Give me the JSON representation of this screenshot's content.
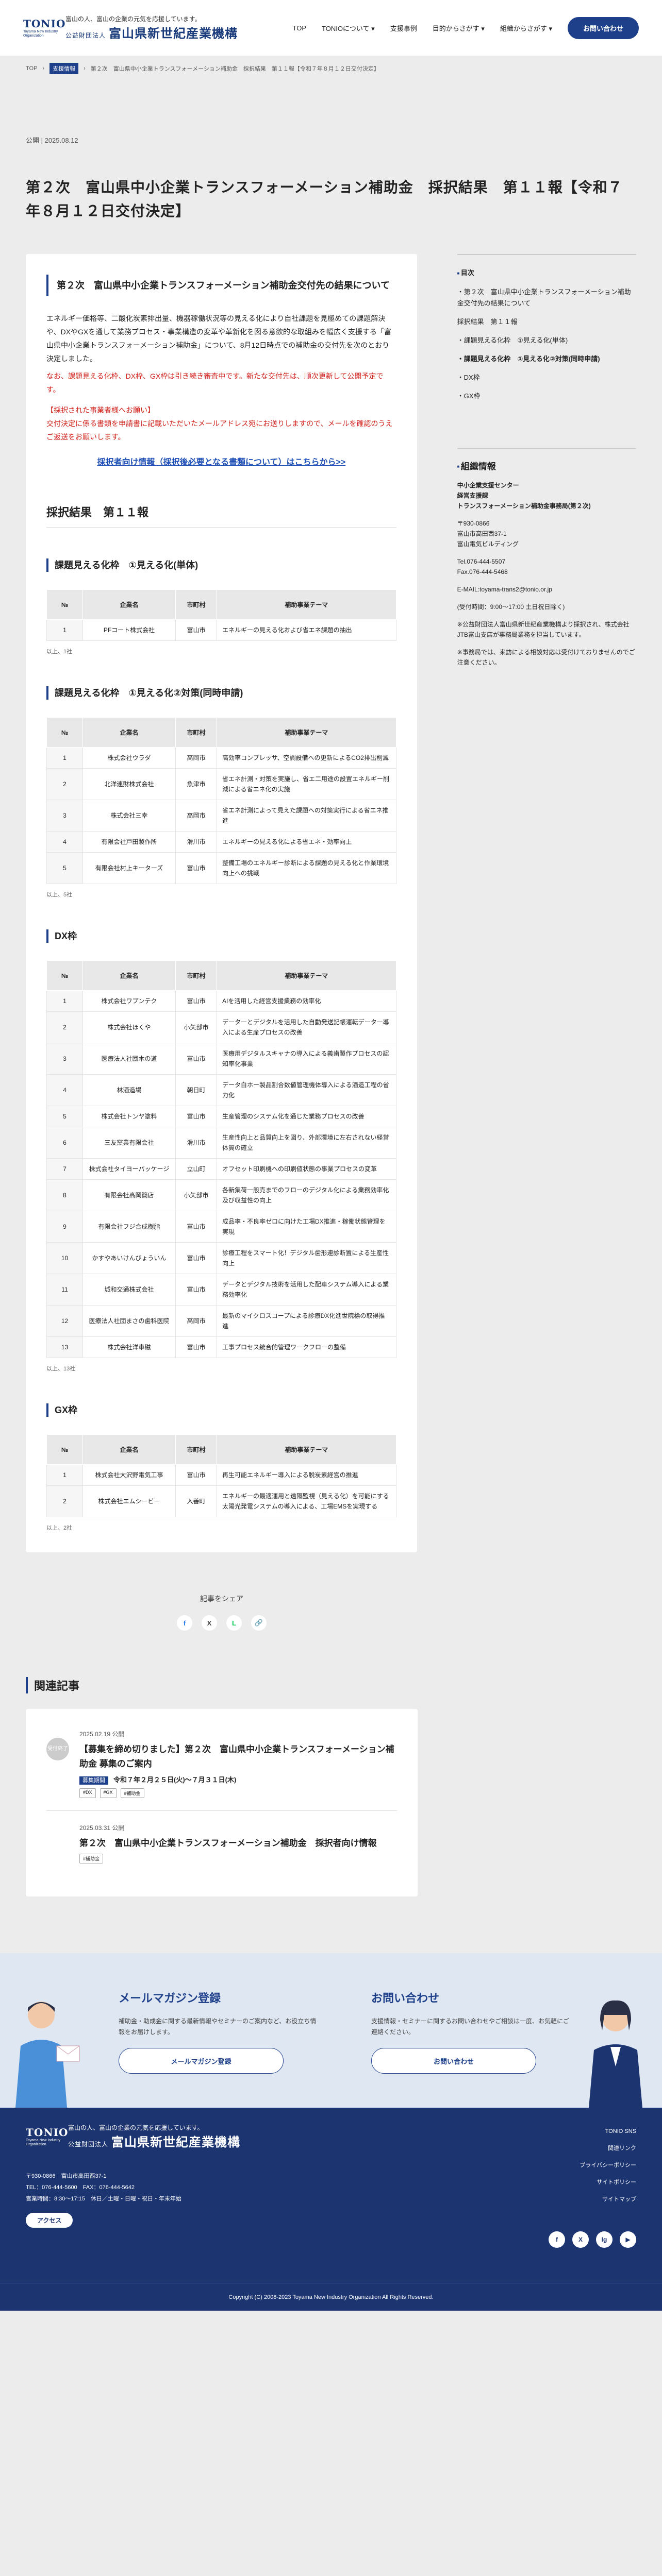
{
  "header": {
    "logo_mark": "TONIO",
    "logo_sub": "Toyama New Industry Organization",
    "tagline": "富山の人、富山の企業の元気を応援しています。",
    "org_prefix": "公益財団法人",
    "org_name": "富山県新世紀産業機構",
    "nav": [
      "TOP",
      "TONIOについて ▾",
      "支援事例",
      "目的からさがす ▾",
      "組織からさがす ▾"
    ],
    "contact": "お問い合わせ"
  },
  "breadcrumb": {
    "top": "TOP",
    "category": "支援情報",
    "current": "第２次　富山県中小企業トランスフォーメーション補助金　採択結果　第１１報【令和７年８月１２日交付決定】"
  },
  "article": {
    "date": "公開 | 2025.08.12",
    "title": "第２次　富山県中小企業トランスフォーメーション補助金　採択結果　第１１報【令和７年８月１２日交付決定】",
    "lead_title": "第２次　富山県中小企業トランスフォーメーション補助金交付先の結果について",
    "p1": "エネルギー価格等、二酸化炭素排出量、機器稼働状況等の見える化により自社課題を見極めての課題解決や、DXやGXを通して業務プロセス・事業構造の変革や革新化を図る意欲的な取組みを幅広く支援する「富山県中小企業トランスフォーメーション補助金」について、8月12日時点での補助金の交付先を次のとおり決定しました。",
    "p2": "なお、課題見える化枠、DX枠、GX枠は引き続き審査中です。新たな交付先は、順次更新して公開予定です。",
    "p3": "【採択された事業者様へお願い】",
    "p4": "交付決定に係る書類を申請書に記載いただいたメールアドレス宛にお送りしますので、メールを確認のうえご返送をお願いします。",
    "link": "採択者向け情報（採択後必要となる書類について）はこちらから>>",
    "results_title": "採択結果　第１１報",
    "col_no": "№",
    "col_company": "企業名",
    "col_city": "市町村",
    "col_theme": "補助事業テーマ",
    "more": "以上、1社",
    "more2": "以上、5社",
    "more3": "以上、13社",
    "more4": "以上、2社"
  },
  "tables": [
    {
      "title": "課題見える化枠　①見える化(単体)",
      "rows": [
        [
          "1",
          "PFコート株式会社",
          "富山市",
          "エネルギーの見える化および省エネ課題の抽出"
        ]
      ]
    },
    {
      "title": "課題見える化枠　①見える化②対策(同時申請)",
      "rows": [
        [
          "1",
          "株式会社ウラダ",
          "高岡市",
          "高効率コンプレッサ、空調設備への更新によるCO2排出削減"
        ],
        [
          "2",
          "北洋連財株式会社",
          "魚津市",
          "省エネ計測・対策を実施し、省エ二用途の設置エネルギー削減による省エネ化の実施"
        ],
        [
          "3",
          "株式会社三幸",
          "高岡市",
          "省エネ計測によって見えた課題への対策実行による省エネ推進"
        ],
        [
          "4",
          "有限会社戸田製作所",
          "滑川市",
          "エネルギーの見える化による省エネ・効率向上"
        ],
        [
          "5",
          "有限会社村上キーターズ",
          "富山市",
          "整備工場のエネルギー診断による課題の見える化と作業環境向上への挑戦"
        ]
      ]
    },
    {
      "title": "DX枠",
      "rows": [
        [
          "1",
          "株式会社ワプンテク",
          "富山市",
          "AIを活用した経営支援業務の効率化"
        ],
        [
          "2",
          "株式会社ほくや",
          "小矢部市",
          "データーとデジタルを活用した自動発送記帳運転データー導入による生産プロセスの改善"
        ],
        [
          "3",
          "医療法人社団木の道",
          "富山市",
          "医療用デジタルスキャナの導入による義歯製作プロセスの認知率化事業"
        ],
        [
          "4",
          "林酒造場",
          "朝日町",
          "データ白ホー製品割合数値管理機体導入による酒造工程の省力化"
        ],
        [
          "5",
          "株式会社トンヤ塗料",
          "富山市",
          "生産管理のシステム化を通じた業務プロセスの改善"
        ],
        [
          "6",
          "三友窯業有限会社",
          "滑川市",
          "生産性向上と品質向上を図り、外部環境に左右されない経営体質の確立"
        ],
        [
          "7",
          "株式会社タイヨーパッケージ",
          "立山町",
          "オフセット印刷機への印刷値状態の事業プロセスの変革"
        ],
        [
          "8",
          "有限会社高岡簡店",
          "小矢部市",
          "各新集荷一般売までのフローのデジタル化による業務効率化及び収益性の向上"
        ],
        [
          "9",
          "有限会社フジ合成樹脂",
          "富山市",
          "成品率・不良率ゼロに向けた工場DX推進・稼働状態管理を実現"
        ],
        [
          "10",
          "かすやあいけんびょういん",
          "富山市",
          "診療工程をスマート化！デジタル歯形連診断置による生産性向上"
        ],
        [
          "11",
          "城和交通株式会社",
          "富山市",
          "データとデジタル技術を活用した配車システム導入による業務効率化"
        ],
        [
          "12",
          "医療法人社団まさの歯科医院",
          "高岡市",
          "最新のマイクロスコープによる診療DX化進世院標の取得推進"
        ],
        [
          "13",
          "株式会社洋車磁",
          "富山市",
          "工事プロセス統合的管理ワークフローの整備"
        ]
      ]
    },
    {
      "title": "GX枠",
      "rows": [
        [
          "1",
          "株式会社大沢野電気工事",
          "富山市",
          "再生可能エネルギー導入による脱炭素経営の推進"
        ],
        [
          "2",
          "株式会社エムシービー",
          "入善町",
          "エネルギーの最適運用と遠隔監視（見える化）を可能にする太陽光発電システムの導入による、工場EMSを実現する"
        ]
      ]
    }
  ],
  "sidebar": {
    "toc_title": "目次",
    "toc": [
      "・第２次　富山県中小企業トランスフォーメーション補助金交付先の結果について",
      "採択結果　第１１報",
      "・課題見える化枠　①見える化(単体)",
      "・課題見える化枠　①見える化②対策(同時申請)",
      "・DX枠",
      "・GX枠"
    ],
    "info_title": "組織情報",
    "info_lines": [
      "中小企業支援センター",
      "経営支援課",
      "トランスフォーメーション補助金事務局(第２次)",
      "",
      "〒930-0866",
      "富山市高田西37-1",
      "富山電気ビルディング",
      "",
      "Tel.076-444-5507",
      "Fax.076-444-5468",
      "",
      "E-MAIL:toyama-trans2@tonio.or.jp",
      "",
      "(受付時間：9:00～17:00 土日祝日除く)",
      "",
      "※公益財団法人富山県新世紀産業機構より採択され、株式会社JTB富山支店が事務局業務を担当しています。",
      "",
      "※事務局では、来訪による相談対応は受付けておりませんのでご注意ください。"
    ]
  },
  "share": {
    "label": "記事をシェア",
    "icons": [
      "f",
      "X",
      "L",
      "🔗"
    ]
  },
  "related": {
    "title": "関連記事",
    "items": [
      {
        "badge": "受付終了",
        "date": "2025.02.19 公開",
        "title": "【募集を締め切りました】第２次　富山県中小企業トランスフォーメーション補助金 募集のご案内",
        "period_label": "募集期間",
        "period": "令和７年２月２５日(火)〜７月３１日(木)",
        "tags": [
          "#DX",
          "#GX",
          "#補助金"
        ]
      },
      {
        "badge": "",
        "date": "2025.03.31 公開",
        "title": "第２次　富山県中小企業トランスフォーメーション補助金　採択者向け情報",
        "period_label": "",
        "period": "",
        "tags": [
          "#補助金"
        ]
      }
    ]
  },
  "promo": {
    "mail_title": "メールマガジン登録",
    "mail_text": "補助金・助成金に関する最新情報やセミナーのご案内など、お役立ち情報をお届けします。",
    "mail_btn": "メールマガジン登録",
    "contact_title": "お問い合わせ",
    "contact_text": "支援情報・セミナーに関するお問い合わせやご相談は一度、お気軽にご連絡ください。",
    "contact_btn": "お問い合わせ"
  },
  "footer": {
    "tagline": "富山の人、富山の企業の元気を応援しています。",
    "org_prefix": "公益財団法人",
    "org_name": "富山県新世紀産業機構",
    "address1": "〒930-0866　富山市高田西37-1",
    "address2": "TEL：076-444-5600　FAX：076-444-5642",
    "hours": "営業時間：8:30〜17:15　休日／土曜・日曜・祝日・年末年始",
    "access": "アクセス",
    "links": [
      "TONIO SNS",
      "関連リンク",
      "プライバシーポリシー",
      "サイトポリシー",
      "サイトマップ"
    ],
    "socials": [
      "f",
      "X",
      "Ig",
      "▶"
    ],
    "copyright": "Copyright (C) 2008-2023 Toyama New Industry Organization All Rights Reserved."
  }
}
